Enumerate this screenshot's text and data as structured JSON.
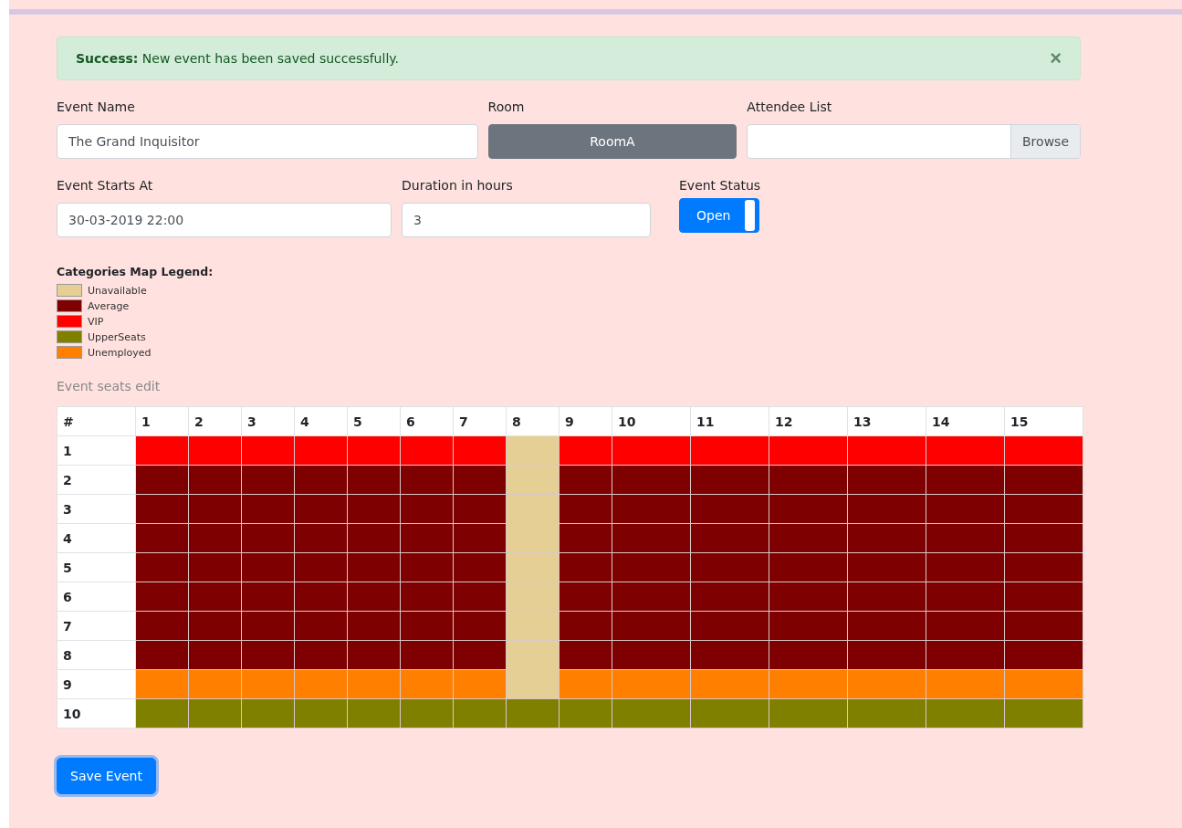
{
  "alert": {
    "title": "Success:",
    "message": "New event has been saved successfully.",
    "close": "×"
  },
  "event_name": {
    "label": "Event Name",
    "value": "The Grand Inquisitor"
  },
  "room": {
    "label": "Room",
    "value": "RoomA"
  },
  "attendee_list": {
    "label": "Attendee List",
    "button": "Browse"
  },
  "event_starts_at": {
    "label": "Event Starts At",
    "value": "30-03-2019 22:00"
  },
  "duration": {
    "label": "Duration in hours",
    "value": "3"
  },
  "event_status": {
    "label": "Event Status",
    "toggle_label": "Open",
    "on": true
  },
  "legend": {
    "title": "Categories Map Legend:",
    "items": [
      {
        "label": "Unavailable",
        "color": "#e5cf94"
      },
      {
        "label": "Average",
        "color": "#7f0000"
      },
      {
        "label": "VIP",
        "color": "#ff0000"
      },
      {
        "label": "UpperSeats",
        "color": "#808000"
      },
      {
        "label": "Unemployed",
        "color": "#ff8000"
      }
    ]
  },
  "seats": {
    "title": "Event seats edit",
    "corner": "#",
    "columns": [
      "1",
      "2",
      "3",
      "4",
      "5",
      "6",
      "7",
      "8",
      "9",
      "10",
      "11",
      "12",
      "13",
      "14",
      "15"
    ],
    "rows": [
      {
        "label": "1",
        "cells": [
          {
            "color": "#ff0000"
          },
          {
            "color": "#ff0000"
          },
          {
            "color": "#ff0000"
          },
          {
            "color": "#ff0000"
          },
          {
            "color": "#ff0000"
          },
          {
            "color": "#ff0000"
          },
          {
            "color": "#ff0000"
          },
          {
            "color": "#e5cf94"
          },
          {
            "color": "#ff0000"
          },
          {
            "color": "#ff0000"
          },
          {
            "color": "#ff0000"
          },
          {
            "color": "#ff0000"
          },
          {
            "color": "#ff0000"
          },
          {
            "color": "#ff0000"
          },
          {
            "color": "#ff0000"
          }
        ]
      },
      {
        "label": "2",
        "cells": [
          {
            "color": "#7f0000"
          },
          {
            "color": "#7f0000"
          },
          {
            "color": "#7f0000"
          },
          {
            "color": "#7f0000"
          },
          {
            "color": "#7f0000"
          },
          {
            "color": "#7f0000"
          },
          {
            "color": "#7f0000"
          },
          {
            "color": "#e5cf94"
          },
          {
            "color": "#7f0000"
          },
          {
            "color": "#7f0000"
          },
          {
            "color": "#7f0000"
          },
          {
            "color": "#7f0000"
          },
          {
            "color": "#7f0000"
          },
          {
            "color": "#7f0000"
          },
          {
            "color": "#7f0000"
          }
        ]
      },
      {
        "label": "3",
        "cells": [
          {
            "color": "#7f0000"
          },
          {
            "color": "#7f0000"
          },
          {
            "color": "#7f0000"
          },
          {
            "color": "#7f0000"
          },
          {
            "color": "#7f0000"
          },
          {
            "color": "#7f0000"
          },
          {
            "color": "#7f0000"
          },
          {
            "color": "#e5cf94"
          },
          {
            "color": "#7f0000"
          },
          {
            "color": "#7f0000"
          },
          {
            "color": "#7f0000"
          },
          {
            "color": "#7f0000"
          },
          {
            "color": "#7f0000"
          },
          {
            "color": "#7f0000"
          },
          {
            "color": "#7f0000"
          }
        ]
      },
      {
        "label": "4",
        "cells": [
          {
            "color": "#7f0000"
          },
          {
            "color": "#7f0000"
          },
          {
            "color": "#7f0000"
          },
          {
            "color": "#7f0000"
          },
          {
            "color": "#7f0000"
          },
          {
            "color": "#7f0000"
          },
          {
            "color": "#7f0000"
          },
          {
            "color": "#e5cf94"
          },
          {
            "color": "#7f0000"
          },
          {
            "color": "#7f0000"
          },
          {
            "color": "#7f0000"
          },
          {
            "color": "#7f0000"
          },
          {
            "color": "#7f0000"
          },
          {
            "color": "#7f0000"
          },
          {
            "color": "#7f0000"
          }
        ]
      },
      {
        "label": "5",
        "cells": [
          {
            "color": "#7f0000"
          },
          {
            "color": "#7f0000"
          },
          {
            "color": "#7f0000"
          },
          {
            "color": "#7f0000"
          },
          {
            "color": "#7f0000"
          },
          {
            "color": "#7f0000"
          },
          {
            "color": "#7f0000"
          },
          {
            "color": "#e5cf94"
          },
          {
            "color": "#7f0000"
          },
          {
            "color": "#7f0000"
          },
          {
            "color": "#7f0000"
          },
          {
            "color": "#7f0000"
          },
          {
            "color": "#7f0000"
          },
          {
            "color": "#7f0000"
          },
          {
            "color": "#7f0000"
          }
        ]
      },
      {
        "label": "6",
        "cells": [
          {
            "color": "#7f0000"
          },
          {
            "color": "#7f0000"
          },
          {
            "color": "#7f0000"
          },
          {
            "color": "#7f0000"
          },
          {
            "color": "#7f0000"
          },
          {
            "color": "#7f0000"
          },
          {
            "color": "#7f0000"
          },
          {
            "color": "#e5cf94"
          },
          {
            "color": "#7f0000"
          },
          {
            "color": "#7f0000"
          },
          {
            "color": "#7f0000"
          },
          {
            "color": "#7f0000"
          },
          {
            "color": "#7f0000"
          },
          {
            "color": "#7f0000"
          },
          {
            "color": "#7f0000"
          }
        ]
      },
      {
        "label": "7",
        "cells": [
          {
            "color": "#7f0000"
          },
          {
            "color": "#7f0000"
          },
          {
            "color": "#7f0000"
          },
          {
            "color": "#7f0000"
          },
          {
            "color": "#7f0000"
          },
          {
            "color": "#7f0000"
          },
          {
            "color": "#7f0000"
          },
          {
            "color": "#e5cf94"
          },
          {
            "color": "#7f0000"
          },
          {
            "color": "#7f0000"
          },
          {
            "color": "#7f0000"
          },
          {
            "color": "#7f0000"
          },
          {
            "color": "#7f0000"
          },
          {
            "color": "#7f0000"
          },
          {
            "color": "#7f0000"
          }
        ]
      },
      {
        "label": "8",
        "cells": [
          {
            "color": "#7f0000"
          },
          {
            "color": "#7f0000"
          },
          {
            "color": "#7f0000"
          },
          {
            "color": "#7f0000"
          },
          {
            "color": "#7f0000"
          },
          {
            "color": "#7f0000"
          },
          {
            "color": "#7f0000"
          },
          {
            "color": "#e5cf94"
          },
          {
            "color": "#7f0000"
          },
          {
            "color": "#7f0000"
          },
          {
            "color": "#7f0000"
          },
          {
            "color": "#7f0000"
          },
          {
            "color": "#7f0000"
          },
          {
            "color": "#7f0000"
          },
          {
            "color": "#7f0000"
          }
        ]
      },
      {
        "label": "9",
        "cells": [
          {
            "color": "#ff8000"
          },
          {
            "color": "#ff8000"
          },
          {
            "color": "#ff8000"
          },
          {
            "color": "#ff8000"
          },
          {
            "color": "#ff8000"
          },
          {
            "color": "#ff8000"
          },
          {
            "color": "#ff8000"
          },
          {
            "color": "#e5cf94"
          },
          {
            "color": "#ff8000"
          },
          {
            "color": "#ff8000"
          },
          {
            "color": "#ff8000"
          },
          {
            "color": "#ff8000"
          },
          {
            "color": "#ff8000"
          },
          {
            "color": "#ff8000"
          },
          {
            "color": "#ff8000"
          }
        ]
      },
      {
        "label": "10",
        "cells": [
          {
            "color": "#808000"
          },
          {
            "color": "#808000"
          },
          {
            "color": "#808000"
          },
          {
            "color": "#808000"
          },
          {
            "color": "#808000"
          },
          {
            "color": "#808000"
          },
          {
            "color": "#808000"
          },
          {
            "color": "#808000"
          },
          {
            "color": "#808000"
          },
          {
            "color": "#808000"
          },
          {
            "color": "#808000"
          },
          {
            "color": "#808000"
          },
          {
            "color": "#808000"
          },
          {
            "color": "#808000"
          },
          {
            "color": "#808000"
          }
        ]
      }
    ]
  },
  "save_button": "Save Event"
}
